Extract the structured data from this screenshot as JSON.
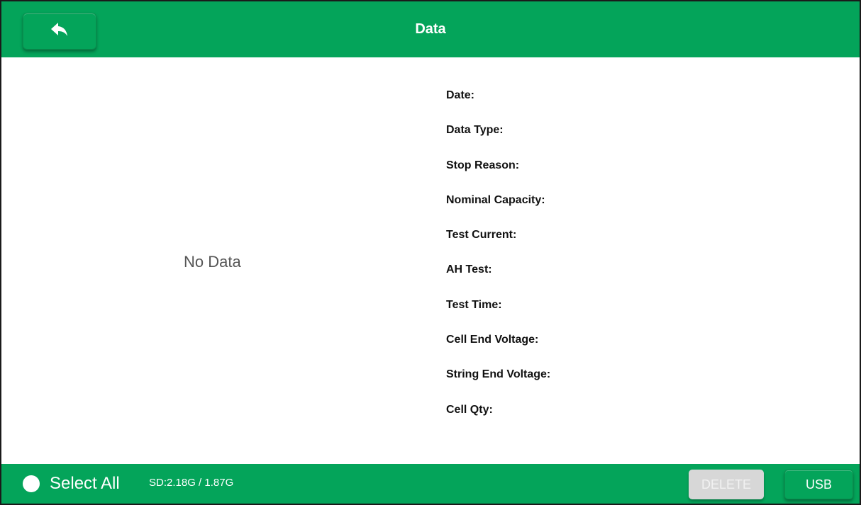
{
  "header": {
    "title": "Data",
    "back_icon": "back-arrow-icon"
  },
  "main": {
    "empty_message": "No Data",
    "details": [
      {
        "label": "Date:"
      },
      {
        "label": "Data Type:"
      },
      {
        "label": "Stop Reason:"
      },
      {
        "label": "Nominal Capacity:"
      },
      {
        "label": "Test Current:"
      },
      {
        "label": "AH Test:"
      },
      {
        "label": "Test Time:"
      },
      {
        "label": "Cell End Voltage:"
      },
      {
        "label": "String End Voltage:"
      },
      {
        "label": "Cell Qty:"
      }
    ]
  },
  "footer": {
    "select_all_label": "Select All",
    "sd_info": "SD:2.18G / 1.87G",
    "delete_label": "DELETE",
    "usb_label": "USB"
  },
  "colors": {
    "brand_green": "#04a45a",
    "disabled_gray": "#d7d7d7",
    "background": "#ffffff"
  }
}
